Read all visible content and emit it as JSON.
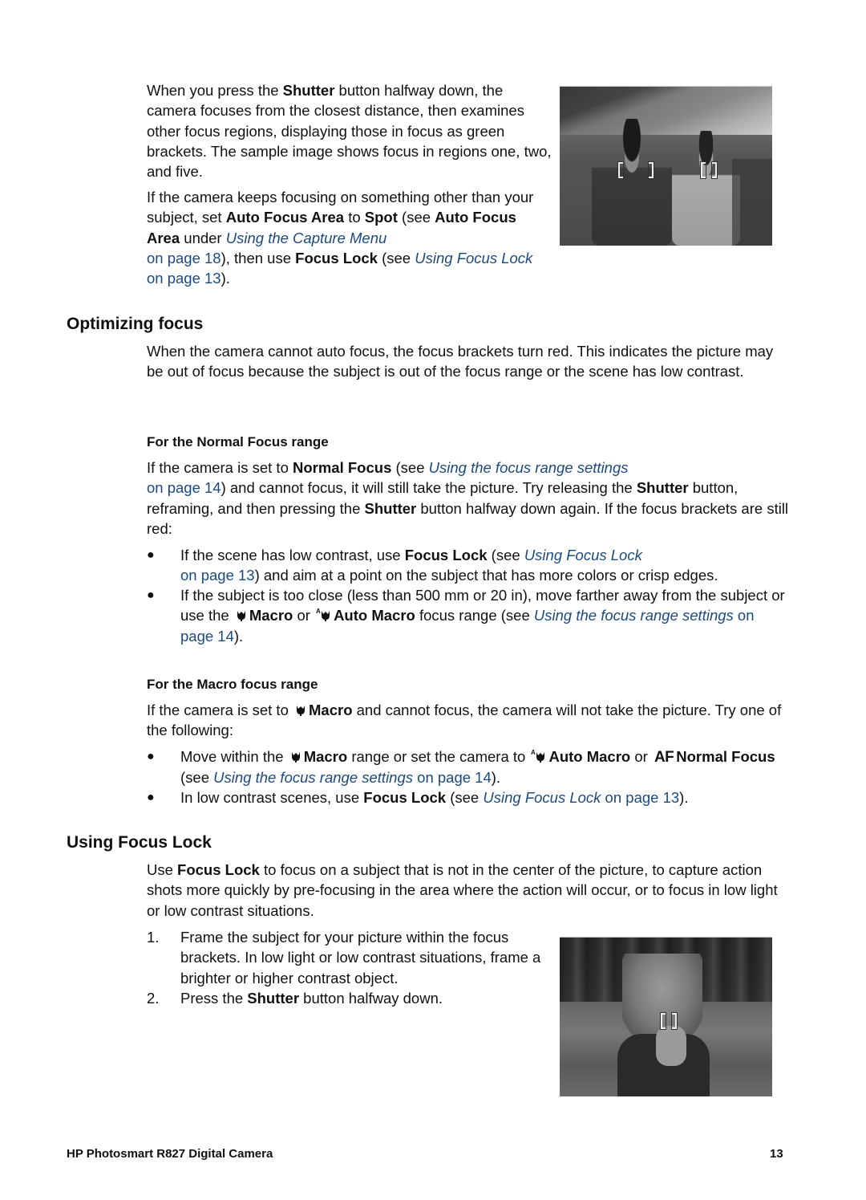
{
  "intro": {
    "p1": {
      "t1": "When you press the ",
      "b1": "Shutter",
      "t2": " button halfway down, the camera focuses from the closest distance, then examines other focus regions, displaying those in focus as green brackets. The sample image shows focus in regions one, two, and five."
    },
    "p2": {
      "t1": "If the camera keeps focusing on something other than your subject, set ",
      "b1": "Auto Focus Area",
      "t2": " to ",
      "b2": "Spot",
      "t3": " (see ",
      "b3": "Auto Focus Area",
      "t4": " under ",
      "link1": "Using the Capture Menu",
      "link1_page": "on page 18",
      "t5": "), then use ",
      "b4": "Focus Lock",
      "t6": " (see ",
      "link2": "Using Focus Lock",
      "link2_page": " on page 13",
      "t7": ")."
    },
    "image_alt": "Two boys on a street with focus brackets on regions"
  },
  "optimizing": {
    "heading": "Optimizing focus",
    "para": "When the camera cannot auto focus, the focus brackets turn red. This indicates the picture may be out of focus because the subject is out of the focus range or the scene has low contrast.",
    "normal": {
      "heading": "For the Normal Focus range",
      "t1": "If the camera is set to ",
      "b1": "Normal Focus",
      "t2": " (see ",
      "link": "Using the focus range settings",
      "link_page": "on page 14",
      "t3": ") and cannot focus, it will still take the picture. Try releasing the ",
      "b2": "Shutter",
      "t4": " button, reframing, and then pressing the ",
      "b3": "Shutter",
      "t5": " button halfway down again. If the focus brackets are still red:",
      "bullets": [
        {
          "t1": "If the scene has low contrast, use ",
          "b1": "Focus Lock",
          "t2": " (see ",
          "link": "Using Focus Lock",
          "link_page": "on page 13",
          "t3": ") and aim at a point on the subject that has more colors or crisp edges."
        },
        {
          "t1": "If the subject is too close (less than 500 mm or 20 in), move farther away from the subject or use the ",
          "icon1": "macro-flower-icon",
          "b1": "Macro",
          "t2": " or ",
          "icon2": "auto-macro-icon",
          "b2": "Auto Macro",
          "t3": " focus range (see ",
          "link": "Using the focus range settings",
          "link_page": " on page 14",
          "t4": ")."
        }
      ]
    },
    "macro": {
      "heading": "For the Macro focus range",
      "t1": "If the camera is set to ",
      "icon1": "macro-flower-icon",
      "b1": "Macro",
      "t2": " and cannot focus, the camera will not take the picture. Try one of the following:",
      "bullets": [
        {
          "t1": "Move within the ",
          "icon1": "macro-flower-icon",
          "b1": "Macro",
          "t2": " range or set the camera to ",
          "icon2": "auto-macro-icon",
          "b2": "Auto Macro",
          "t3": " or ",
          "icon3": "AF",
          "b3": "Normal Focus",
          "t4": " (see ",
          "link": "Using the focus range settings",
          "link_page": " on page 14",
          "t5": ")."
        },
        {
          "t1": "In low contrast scenes, use ",
          "b1": "Focus Lock",
          "t2": " (see ",
          "link": "Using Focus Lock",
          "link_page": " on page 13",
          "t3": ")."
        }
      ]
    }
  },
  "focus_lock": {
    "heading": "Using Focus Lock",
    "intro_t1": "Use ",
    "intro_b1": "Focus Lock",
    "intro_t2": " to focus on a subject that is not in the center of the picture, to capture action shots more quickly by pre-focusing in the area where the action will occur, or to focus in low light or low contrast situations.",
    "steps": [
      {
        "num": "1.",
        "text": "Frame the subject for your picture within the focus brackets. In low light or low contrast situations, frame a brighter or higher contrast object."
      },
      {
        "num": "2.",
        "t1": "Press the ",
        "b1": "Shutter",
        "t2": " button halfway down."
      }
    ],
    "image_alt": "Girl holding camera with focus bracket"
  },
  "footer": {
    "title": "HP Photosmart R827 Digital Camera",
    "page": "13"
  },
  "colors": {
    "link": "#1c4a7e",
    "text": "#111111"
  }
}
